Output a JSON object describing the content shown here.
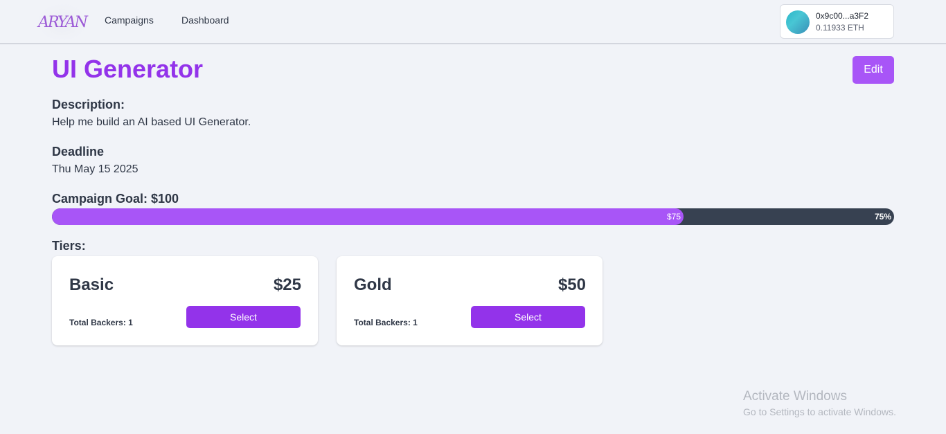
{
  "nav": {
    "logo_text": "ARYAN",
    "links": [
      "Campaigns",
      "Dashboard"
    ]
  },
  "wallet": {
    "address": "0x9c00...a3F2",
    "balance": "0.11933 ETH"
  },
  "campaign": {
    "title": "UI Generator",
    "edit_label": "Edit",
    "description_label": "Description:",
    "description": "Help me build an AI based UI Generator.",
    "deadline_label": "Deadline",
    "deadline": "Thu May 15 2025",
    "goal_label": "Campaign Goal: $100",
    "raised_label": "$75",
    "progress_percent": 75,
    "progress_label": "75%",
    "tiers_label": "Tiers:"
  },
  "tiers": [
    {
      "name": "Basic",
      "price": "$25",
      "backers": "Total Backers: 1",
      "select_label": "Select"
    },
    {
      "name": "Gold",
      "price": "$50",
      "backers": "Total Backers: 1",
      "select_label": "Select"
    }
  ],
  "os_watermark": {
    "line1": "Activate Windows",
    "line2": "Go to Settings to activate Windows."
  },
  "colors": {
    "accent": "#9333ea",
    "accent_light": "#a855f7",
    "track": "#374151"
  }
}
